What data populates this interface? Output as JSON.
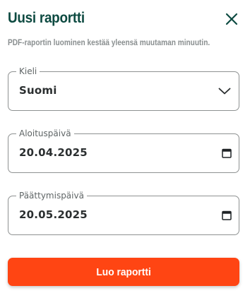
{
  "dialog": {
    "title": "Uusi raportti",
    "subtitle": "PDF-raportin luominen kestää yleensä muutaman minuutin.",
    "close_icon": "close-icon"
  },
  "form": {
    "language": {
      "label": "Kieli",
      "value": "Suomi",
      "icon": "chevron-down-icon"
    },
    "start_date": {
      "label": "Aloituspäivä",
      "value": "20.04.2025",
      "icon": "calendar-icon"
    },
    "end_date": {
      "label": "Päättymispäivä",
      "value": "20.05.2025",
      "icon": "calendar-icon"
    }
  },
  "actions": {
    "submit_label": "Luo raportti"
  },
  "colors": {
    "title": "#0d4a41",
    "accent_button": "#ff4513",
    "border": "#8e9191"
  }
}
